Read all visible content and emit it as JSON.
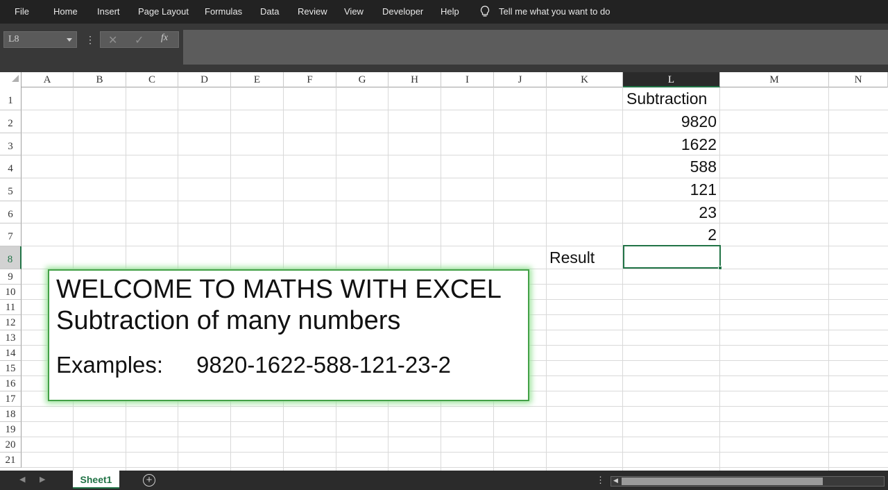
{
  "menu": {
    "items": [
      "File",
      "Home",
      "Insert",
      "Page Layout",
      "Formulas",
      "Data",
      "Review",
      "View",
      "Developer",
      "Help"
    ],
    "tell_me": "Tell me what you want to do"
  },
  "formula_bar": {
    "name_box": "L8",
    "fx_label": "fx",
    "formula": ""
  },
  "grid": {
    "columns": [
      "A",
      "B",
      "C",
      "D",
      "E",
      "F",
      "G",
      "H",
      "I",
      "J",
      "K",
      "L",
      "M",
      "N"
    ],
    "selected_column": "L",
    "rows": [
      "1",
      "2",
      "3",
      "4",
      "5",
      "6",
      "7",
      "8",
      "9",
      "10",
      "11",
      "12",
      "13",
      "14",
      "15",
      "16",
      "17",
      "18",
      "19",
      "20",
      "21"
    ],
    "selected_row": "8",
    "cells": {
      "L1": "Subtraction",
      "L2": "9820",
      "L3": "1622",
      "L4": "588",
      "L5": "121",
      "L6": "23",
      "L7": "2",
      "K8": "Result"
    },
    "selected_cell": "L8"
  },
  "textbox": {
    "title": "WELCOME TO MATHS WITH EXCEL",
    "subtitle": "Subtraction of many numbers",
    "examples_label": "Examples:",
    "examples_value": "9820-1622-588-121-23-2"
  },
  "sheets": {
    "tabs": [
      "Sheet1"
    ],
    "active": "Sheet1"
  },
  "colors": {
    "accent": "#217346",
    "ribbon_bg": "#222222",
    "textbox_border": "#43a047"
  }
}
